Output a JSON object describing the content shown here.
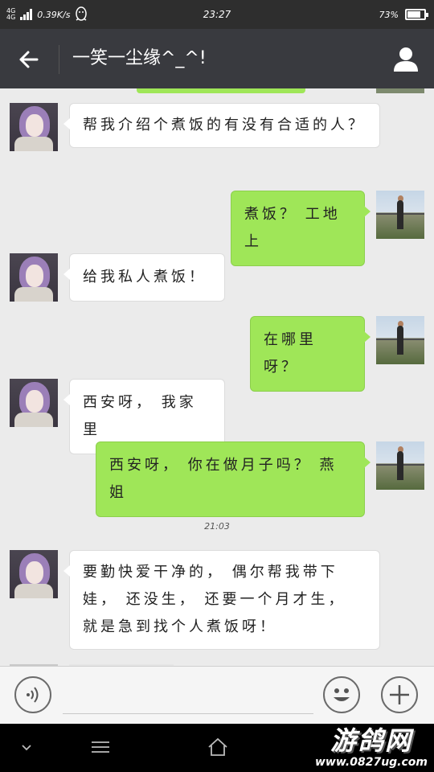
{
  "status_bar": {
    "network_top": "4G",
    "network_second": "4G",
    "speed": "0.39K/s",
    "time": "23:27",
    "battery": "73%",
    "battery_level": 0.73
  },
  "header": {
    "title": "一笑一尘缘^_^!"
  },
  "messages": [
    {
      "side": "in",
      "text": "帮我介绍个煮饭的有没有合适的人？"
    },
    {
      "side": "out",
      "text": "煮饭？ 工地上"
    },
    {
      "side": "in",
      "text": "给我私人煮饭！"
    },
    {
      "side": "out",
      "text": "在哪里呀？"
    },
    {
      "side": "in",
      "text": "西安呀， 我家里"
    },
    {
      "side": "out",
      "text": "西安呀， 你在做月子吗？ 燕姐"
    },
    {
      "side": "in",
      "text": "要勤快爱干净的， 偶尔帮我带下娃， 还没生， 还要一个月才生， 就是急到找个人煮饭呀！"
    }
  ],
  "timestamp": "21:03",
  "watermark": {
    "name": "游鸽网",
    "url": "www.0827ug.com"
  },
  "colors": {
    "status_bar": "#2e2e2e",
    "title_bar": "#393a3f",
    "chat_bg": "#ebebeb",
    "outgoing_bubble": "#9fe658",
    "incoming_bubble": "#ffffff"
  }
}
